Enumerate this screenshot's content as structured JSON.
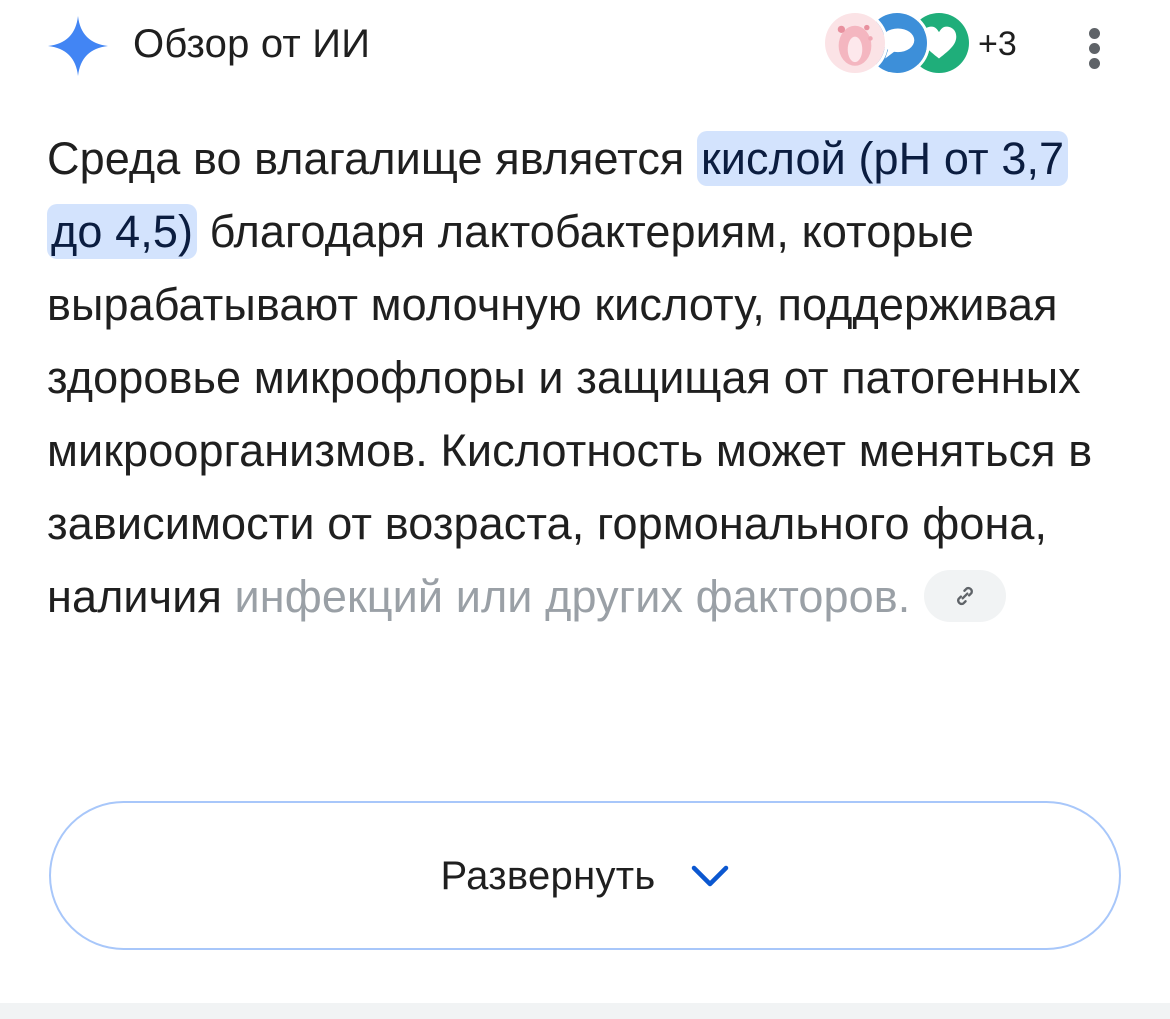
{
  "header": {
    "title": "Обзор от ИИ",
    "sparkle_icon": "ai-sparkle-icon",
    "sparkle_color": "#4285f4",
    "sources_more": "+3",
    "menu_icon": "more-vert-icon"
  },
  "answer": {
    "pre": "Среда во влагалище является ",
    "highlight": "кислой (pH от 3,7 до 4,5)",
    "main": " благодаря лактобактериям, которые вырабатывают молочную кислоту, поддерживая здоровье микрофлоры и защищая от патогенных микроорганизмов. Кислотность может меняться в зависимости от возраста, гормонального фона, наличия ",
    "faded": "инфекций или других факторов.",
    "link_icon": "link-icon"
  },
  "expand": {
    "label": "Развернуть",
    "icon": "chevron-down-icon"
  },
  "colors": {
    "highlight_bg": "#d3e3fd",
    "button_border": "#a8c7fa",
    "chevron": "#0b57d0"
  }
}
